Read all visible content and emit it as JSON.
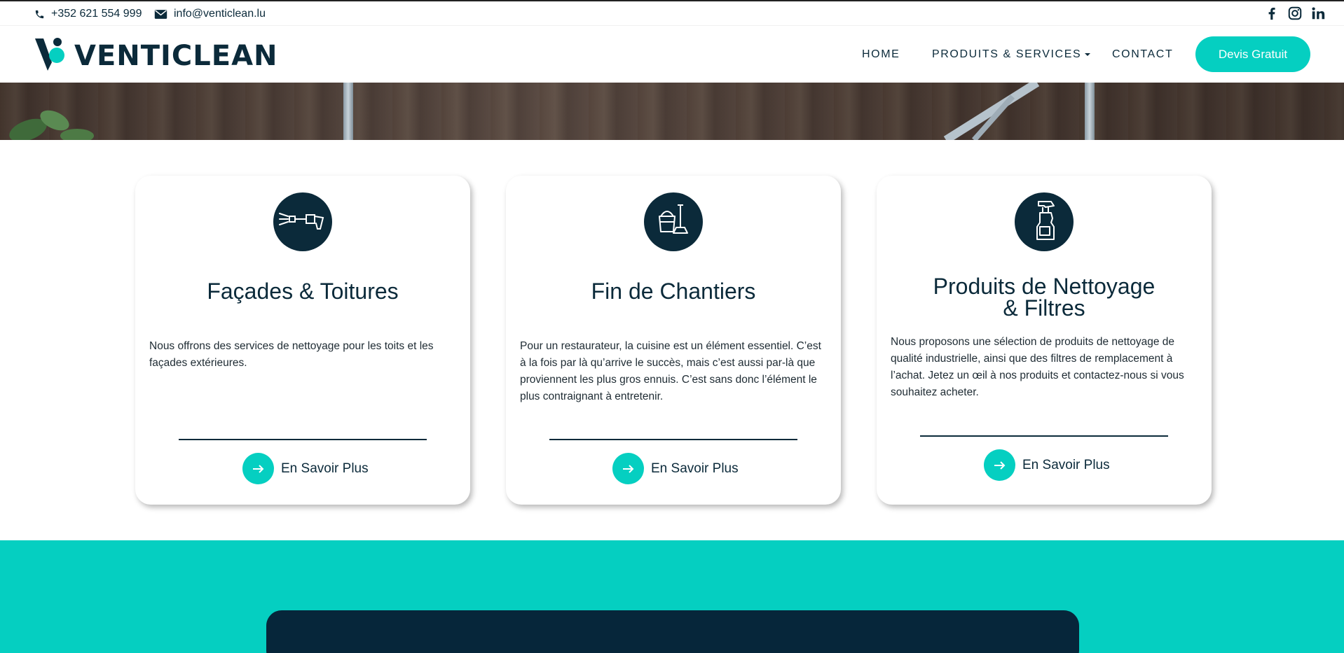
{
  "topbar": {
    "phone": "+352 621 554 999",
    "email": "info@venticlean.lu",
    "icons": [
      "phone-icon",
      "mail-icon",
      "facebook-icon",
      "instagram-icon",
      "linkedin-icon"
    ]
  },
  "header": {
    "logo_text": "VENTICLEAN",
    "nav": {
      "home": "HOME",
      "products": "PRODUITS & SERVICES",
      "contact": "CONTACT"
    },
    "cta": "Devis Gratuit"
  },
  "colors": {
    "accent": "#05cfc1",
    "navy": "#0b2a3a"
  },
  "cards": [
    {
      "icon": "pressure-washer-icon",
      "title": "Façades & Toitures",
      "text": "Nous offrons des services de nettoyage pour les toits et les façades extérieures.",
      "link": "En Savoir Plus"
    },
    {
      "icon": "bucket-broom-icon",
      "title": "Fin de Chantiers",
      "text": "Pour un restaurateur, la cuisine est un élément essentiel. C’est à la fois par là qu’arrive le succès, mais c’est aussi par-là que proviennent les plus gros ennuis. C’est sans donc l’élément le plus contraignant à entretenir.",
      "link": "En Savoir Plus"
    },
    {
      "icon": "spray-bottle-icon",
      "title_line1": "Produits de Nettoyage",
      "title_line2": "& Filtres",
      "text": "Nous proposons une sélection de produits de nettoyage de qualité industrielle, ainsi que des filtres de remplacement à l’achat. Jetez un œil à nos produits et contactez-nous si vous souhaitez acheter.",
      "link": "En Savoir Plus"
    }
  ]
}
